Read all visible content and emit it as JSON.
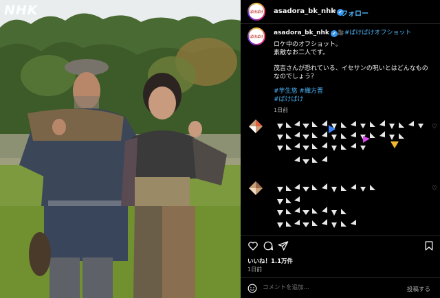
{
  "photo": {
    "watermark": "NHK"
  },
  "post_header": {
    "username": "asadora_bk_nhk",
    "verified_mark": "✔",
    "separator": "•",
    "follow_label": "フォロー"
  },
  "caption": {
    "username": "asadora_bk_nhk",
    "tag_icon": "🎥",
    "lines": [
      "#ばけばけオフショット",
      "ロケ中のオフショット。",
      "素敵なお二人です。",
      "",
      "茂吉さんが恐れている、イセサンの呪いとはどんなものなのでしょう？",
      "",
      "#芋生悠 #織方晋",
      "#ばけばけ"
    ],
    "time": "1日前"
  },
  "post_footer": {
    "likes": "いいね！1.1万件",
    "time": "1日前",
    "comment_placeholder": "コメントを追加...",
    "post_label": "投稿する"
  },
  "colors": {
    "accent_link": "#4cb5f9",
    "verified": "#3897f0",
    "background": "#000000"
  },
  "icons": [
    "emoji-icon",
    "heart-icon",
    "comment-icon",
    "share-icon",
    "bookmark-icon",
    "verified-icon"
  ]
}
